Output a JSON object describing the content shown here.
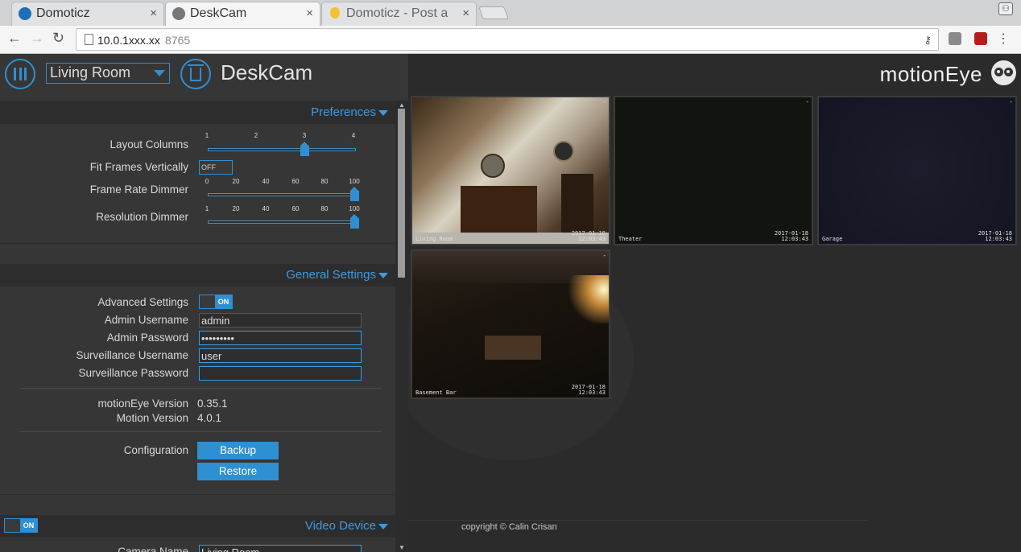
{
  "browser": {
    "tabs": [
      {
        "title": "Domoticz",
        "close": "×"
      },
      {
        "title": "DeskCam",
        "close": "×"
      },
      {
        "title": "Domoticz - Post a",
        "close": "×"
      }
    ],
    "url_host": "10.0.1xxx.xx",
    "url_rest": "8765",
    "profile_icon": "user-icon",
    "menu_glyph": "⋮"
  },
  "header": {
    "camera_select": "Living Room",
    "camera_title": "DeskCam"
  },
  "preferences": {
    "title": "Preferences",
    "layout_columns": {
      "label": "Layout Columns",
      "ticks": [
        "1",
        "2",
        "3",
        "4"
      ],
      "value": 3
    },
    "fit_frames": {
      "label": "Fit Frames Vertically",
      "state": "OFF"
    },
    "frame_rate_dimmer": {
      "label": "Frame Rate Dimmer",
      "ticks": [
        "0",
        "20",
        "40",
        "60",
        "80",
        "100"
      ],
      "value": 100
    },
    "resolution_dimmer": {
      "label": "Resolution Dimmer",
      "ticks": [
        "1",
        "20",
        "40",
        "60",
        "80",
        "100"
      ],
      "value": 100
    }
  },
  "general": {
    "title": "General Settings",
    "advanced": {
      "label": "Advanced Settings",
      "state": "ON"
    },
    "admin_username": {
      "label": "Admin Username",
      "value": "admin"
    },
    "admin_password": {
      "label": "Admin Password",
      "value": "•••••••••"
    },
    "surv_username": {
      "label": "Surveillance Username",
      "value": "user"
    },
    "surv_password": {
      "label": "Surveillance Password",
      "value": ""
    },
    "motioneye_version": {
      "label": "motionEye Version",
      "value": "0.35.1"
    },
    "motion_version": {
      "label": "Motion Version",
      "value": "4.0.1"
    },
    "configuration": {
      "label": "Configuration",
      "backup": "Backup",
      "restore": "Restore"
    }
  },
  "video_device": {
    "title": "Video Device",
    "state": "ON",
    "camera_name_label": "Camera Name",
    "camera_name_value": "Living Room"
  },
  "camarea": {
    "brand": "motionEye",
    "copyright": "copyright © Calin Crisan",
    "frames": [
      {
        "name": "Living Room",
        "date": "2017-01-18",
        "time": "12:03:43",
        "dash": "-"
      },
      {
        "name": "Theater",
        "date": "2017-01-18",
        "time": "12:03:43",
        "dash": "-"
      },
      {
        "name": "Garage",
        "date": "2017-01-18",
        "time": "12:03:43",
        "dash": "-"
      },
      {
        "name": "Basement Bar",
        "date": "2017-01-18",
        "time": "12:03:43",
        "dash": "-"
      }
    ]
  },
  "colors": {
    "accent": "#2f8fd3",
    "panel": "#363636",
    "camera_bg": "#2b2b2b"
  }
}
